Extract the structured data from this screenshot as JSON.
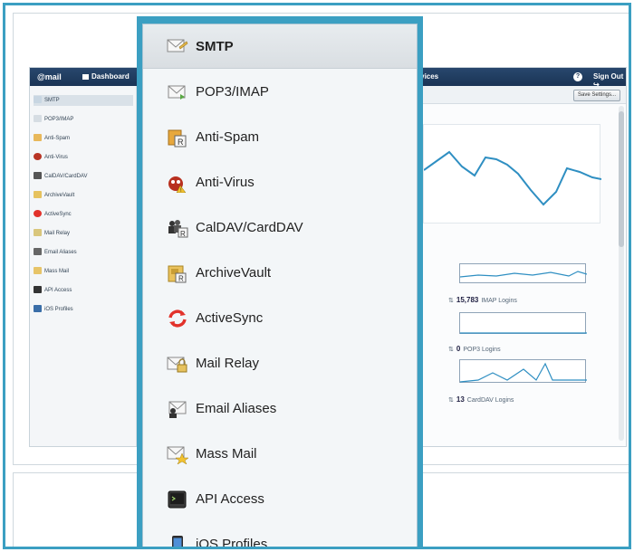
{
  "app": {
    "brand": "mail",
    "dashboard": "Dashboard",
    "topbar_partial": "rvices",
    "sign_out": "Sign Out",
    "save_settings": "Save Settings..."
  },
  "small_sidebar": [
    "SMTP",
    "POP3/IMAP",
    "Anti-Spam",
    "Anti-Virus",
    "CalDAV/CardDAV",
    "ArchiveVault",
    "ActiveSync",
    "Mail Relay",
    "Email Aliases",
    "Mass Mail",
    "API Access",
    "iOS Profiles"
  ],
  "stats": [
    {
      "value": "15,783",
      "label": "IMAP Logins"
    },
    {
      "value": "0",
      "label": "POP3 Logins"
    },
    {
      "value": "13",
      "label": "CardDAV Logins"
    }
  ],
  "menu": {
    "items": [
      {
        "label": "SMTP",
        "icon": "smtp-envelope-icon"
      },
      {
        "label": "POP3/IMAP",
        "icon": "inbox-envelope-icon"
      },
      {
        "label": "Anti-Spam",
        "icon": "anti-spam-icon"
      },
      {
        "label": "Anti-Virus",
        "icon": "anti-virus-bug-icon"
      },
      {
        "label": "CalDAV/CardDAV",
        "icon": "contacts-icon"
      },
      {
        "label": "ArchiveVault",
        "icon": "archive-vault-icon"
      },
      {
        "label": "ActiveSync",
        "icon": "sync-arrows-icon"
      },
      {
        "label": "Mail Relay",
        "icon": "mail-relay-icon"
      },
      {
        "label": "Email Aliases",
        "icon": "email-alias-icon"
      },
      {
        "label": "Mass Mail",
        "icon": "mass-mail-icon"
      },
      {
        "label": "API Access",
        "icon": "terminal-icon"
      },
      {
        "label": "iOS Profiles",
        "icon": "phone-icon"
      }
    ]
  },
  "colors": {
    "frame": "#3b9fc2",
    "topbar": "#1a3455",
    "chart_line": "#2f8fc2",
    "sync_red": "#e2322b"
  }
}
